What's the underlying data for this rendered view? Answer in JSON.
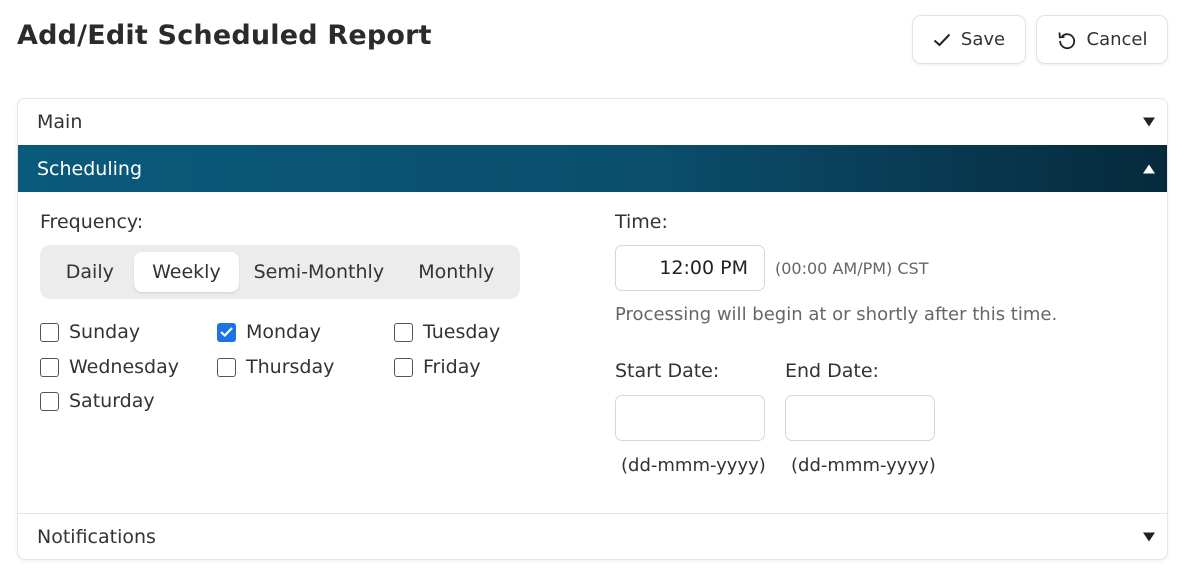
{
  "page": {
    "title": "Add/Edit Scheduled Report"
  },
  "toolbar": {
    "save_label": "Save",
    "cancel_label": "Cancel"
  },
  "sections": {
    "main": "Main",
    "scheduling": "Scheduling",
    "notifications": "Notifications"
  },
  "scheduling": {
    "frequency_label": "Frequency:",
    "frequency_options": [
      "Daily",
      "Weekly",
      "Semi-Monthly",
      "Monthly"
    ],
    "frequency_selected": "Weekly",
    "days": [
      {
        "label": "Sunday",
        "checked": false
      },
      {
        "label": "Monday",
        "checked": true
      },
      {
        "label": "Tuesday",
        "checked": false
      },
      {
        "label": "Wednesday",
        "checked": false
      },
      {
        "label": "Thursday",
        "checked": false
      },
      {
        "label": "Friday",
        "checked": false
      },
      {
        "label": "Saturday",
        "checked": false
      }
    ],
    "time_label": "Time:",
    "time_value": "12:00 PM",
    "time_hint": "(00:00 AM/PM) CST",
    "time_help": "Processing will begin at or shortly after this time.",
    "start_date_label": "Start Date:",
    "start_date_value": "",
    "start_date_format": "(dd-mmm-yyyy)",
    "end_date_label": "End Date:",
    "end_date_value": "",
    "end_date_format": "(dd-mmm-yyyy)"
  },
  "colors": {
    "accent": "#0b4e6d",
    "checkbox_checked": "#1a73e8"
  }
}
